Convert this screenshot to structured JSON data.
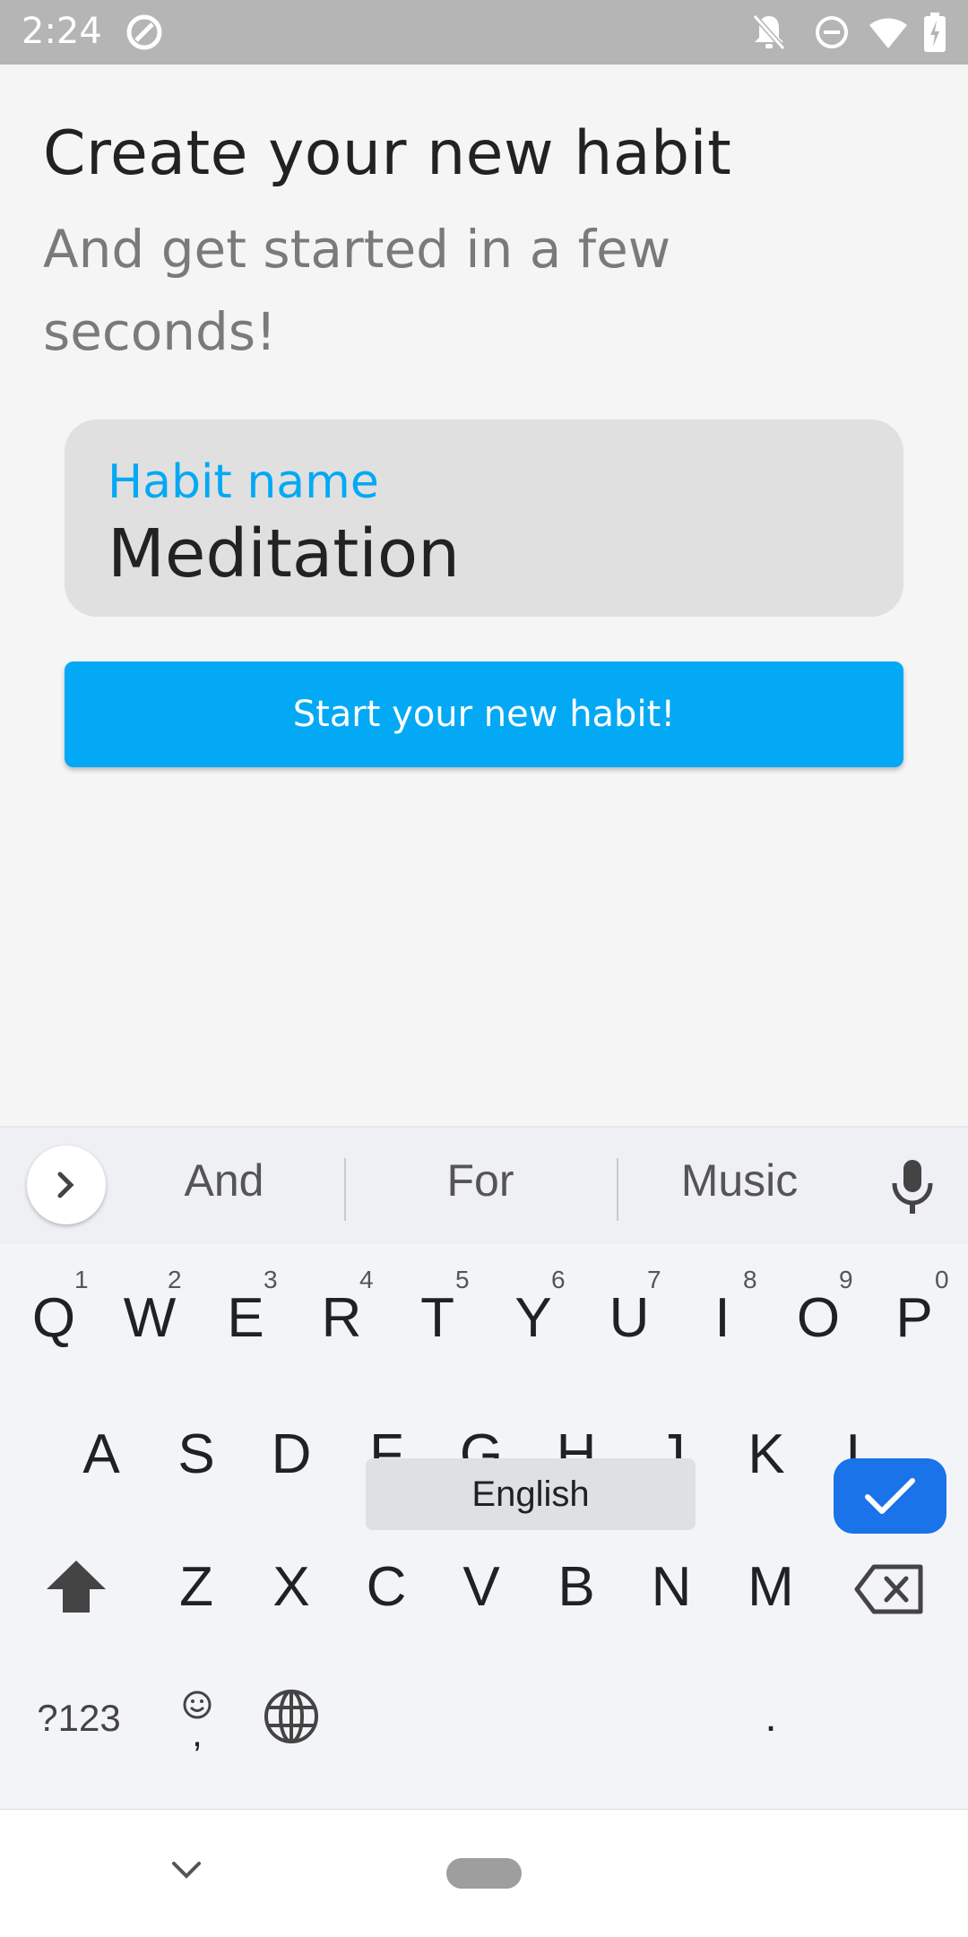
{
  "status_bar": {
    "time": "2:24"
  },
  "header": {
    "title": "Create your new habit",
    "subtitle": "And get started in a few seconds!"
  },
  "form": {
    "field_label": "Habit name",
    "field_value": "Meditation",
    "submit_label": "Start your new habit!"
  },
  "keyboard": {
    "suggestions": [
      "And",
      "For",
      "Music"
    ],
    "row1": [
      "Q",
      "W",
      "E",
      "R",
      "T",
      "Y",
      "U",
      "I",
      "O",
      "P"
    ],
    "row1_hints": [
      "1",
      "2",
      "3",
      "4",
      "5",
      "6",
      "7",
      "8",
      "9",
      "0"
    ],
    "row2": [
      "A",
      "S",
      "D",
      "F",
      "G",
      "H",
      "J",
      "K",
      "L"
    ],
    "row3": [
      "Z",
      "X",
      "C",
      "V",
      "B",
      "N",
      "M"
    ],
    "symbols_label": "?123",
    "comma_label": ",",
    "space_label": "English",
    "period_label": "."
  },
  "colors": {
    "accent": "#03a9f4",
    "keyboard_enter": "#1a73e8"
  }
}
